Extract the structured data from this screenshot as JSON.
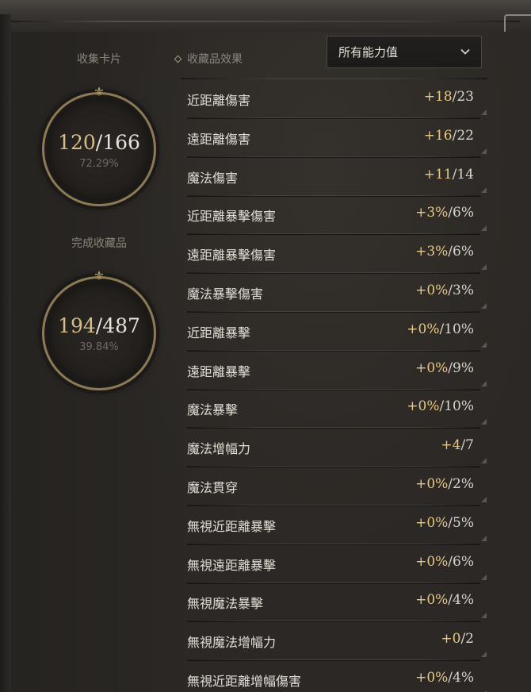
{
  "left_panel": {
    "cards": {
      "label": "收集卡片",
      "current": "120",
      "separator": "/",
      "total": "166",
      "percent": "72.29%"
    },
    "collection": {
      "label": "完成收藏品",
      "current": "194",
      "separator": "/",
      "total": "487",
      "percent": "39.84%"
    }
  },
  "effects": {
    "title": "收藏品效果",
    "filter": {
      "selected": "所有能力值"
    },
    "rows": [
      {
        "label": "近距離傷害",
        "current": "+18",
        "max": "/23"
      },
      {
        "label": "遠距離傷害",
        "current": "+16",
        "max": "/22"
      },
      {
        "label": "魔法傷害",
        "current": "+11",
        "max": "/14"
      },
      {
        "label": "近距離暴擊傷害",
        "current": "+3%",
        "max": "/6%"
      },
      {
        "label": "遠距離暴擊傷害",
        "current": "+3%",
        "max": "/6%"
      },
      {
        "label": "魔法暴擊傷害",
        "current": "+0%",
        "max": "/3%"
      },
      {
        "label": "近距離暴擊",
        "current": "+0%",
        "max": "/10%"
      },
      {
        "label": "遠距離暴擊",
        "current": "+0%",
        "max": "/9%"
      },
      {
        "label": "魔法暴擊",
        "current": "+0%",
        "max": "/10%"
      },
      {
        "label": "魔法增幅力",
        "current": "+4",
        "max": "/7"
      },
      {
        "label": "魔法貫穿",
        "current": "+0%",
        "max": "/2%"
      },
      {
        "label": "無視近距離暴擊",
        "current": "+0%",
        "max": "/5%"
      },
      {
        "label": "無視遠距離暴擊",
        "current": "+0%",
        "max": "/6%"
      },
      {
        "label": "無視魔法暴擊",
        "current": "+0%",
        "max": "/4%"
      },
      {
        "label": "無視魔法增幅力",
        "current": "+0",
        "max": "/2"
      },
      {
        "label": "無視近距離增幅傷害",
        "current": "+0%",
        "max": "/4%"
      }
    ]
  },
  "colors": {
    "accent_gold": "#e8c887",
    "ring_gold": "#8d7a55",
    "background": "#2a2724"
  },
  "icons": {
    "effects_title": "diamond-icon",
    "dropdown": "chevron-down-icon",
    "ring_top": "fleur-ornament-icon",
    "row_corner": "corner-triangle-icon"
  }
}
